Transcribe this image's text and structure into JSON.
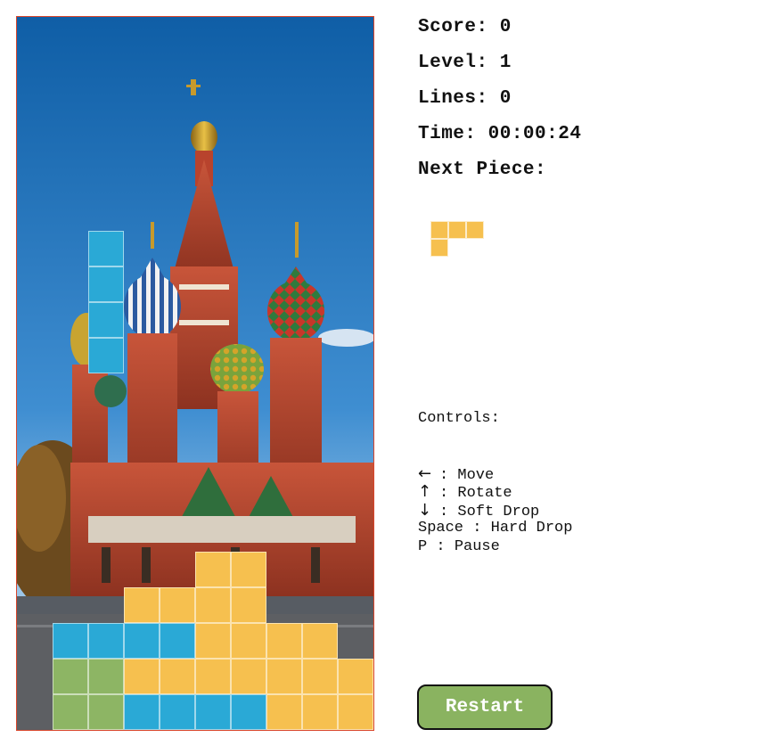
{
  "stats": {
    "score_label": "Score:",
    "score": "0",
    "level_label": "Level:",
    "level": "1",
    "lines_label": "Lines:",
    "lines": "0",
    "time_label": "Time:",
    "time": "00:00:24",
    "next_label": "Next Piece:"
  },
  "next_piece": {
    "color": "#f6c04f",
    "cells": [
      [
        0,
        0
      ],
      [
        1,
        0
      ],
      [
        2,
        0
      ],
      [
        0,
        1
      ]
    ]
  },
  "controls": {
    "title": "Controls:",
    "items": [
      {
        "key": "←",
        "sep": " : ",
        "action": "Move",
        "icon": "left-arrow-icon"
      },
      {
        "key": "↑",
        "sep": " : ",
        "action": "Rotate",
        "icon": "up-arrow-icon"
      },
      {
        "key": "↓",
        "sep": " : ",
        "action": "Soft Drop",
        "icon": "down-arrow-icon"
      },
      {
        "key": "Space",
        "sep": " : ",
        "action": "Hard Drop"
      },
      {
        "key": "P",
        "sep": " : ",
        "action": "Pause"
      }
    ]
  },
  "restart_label": "Restart",
  "colors": {
    "I": "#2aa9d6",
    "O": "#f6c04f",
    "G": "#8db564",
    "border": "#d9452b"
  },
  "board": {
    "cols": 10,
    "rows": 20,
    "falling_piece": {
      "color": "I",
      "cells": [
        [
          2,
          6
        ],
        [
          2,
          7
        ],
        [
          2,
          8
        ],
        [
          2,
          9
        ]
      ]
    },
    "locked": [
      {
        "c": 5,
        "r": 15,
        "color": "O"
      },
      {
        "c": 6,
        "r": 15,
        "color": "O"
      },
      {
        "c": 3,
        "r": 16,
        "color": "O"
      },
      {
        "c": 4,
        "r": 16,
        "color": "O"
      },
      {
        "c": 5,
        "r": 16,
        "color": "O"
      },
      {
        "c": 6,
        "r": 16,
        "color": "O"
      },
      {
        "c": 1,
        "r": 17,
        "color": "I"
      },
      {
        "c": 2,
        "r": 17,
        "color": "I"
      },
      {
        "c": 3,
        "r": 17,
        "color": "I"
      },
      {
        "c": 4,
        "r": 17,
        "color": "I"
      },
      {
        "c": 5,
        "r": 17,
        "color": "O"
      },
      {
        "c": 6,
        "r": 17,
        "color": "O"
      },
      {
        "c": 7,
        "r": 17,
        "color": "O"
      },
      {
        "c": 8,
        "r": 17,
        "color": "O"
      },
      {
        "c": 1,
        "r": 18,
        "color": "G"
      },
      {
        "c": 2,
        "r": 18,
        "color": "G"
      },
      {
        "c": 3,
        "r": 18,
        "color": "O"
      },
      {
        "c": 4,
        "r": 18,
        "color": "O"
      },
      {
        "c": 5,
        "r": 18,
        "color": "O"
      },
      {
        "c": 6,
        "r": 18,
        "color": "O"
      },
      {
        "c": 7,
        "r": 18,
        "color": "O"
      },
      {
        "c": 8,
        "r": 18,
        "color": "O"
      },
      {
        "c": 9,
        "r": 18,
        "color": "O"
      },
      {
        "c": 1,
        "r": 19,
        "color": "G"
      },
      {
        "c": 2,
        "r": 19,
        "color": "G"
      },
      {
        "c": 3,
        "r": 19,
        "color": "I"
      },
      {
        "c": 4,
        "r": 19,
        "color": "I"
      },
      {
        "c": 5,
        "r": 19,
        "color": "I"
      },
      {
        "c": 6,
        "r": 19,
        "color": "I"
      },
      {
        "c": 7,
        "r": 19,
        "color": "O"
      },
      {
        "c": 8,
        "r": 19,
        "color": "O"
      },
      {
        "c": 9,
        "r": 19,
        "color": "O"
      }
    ]
  }
}
